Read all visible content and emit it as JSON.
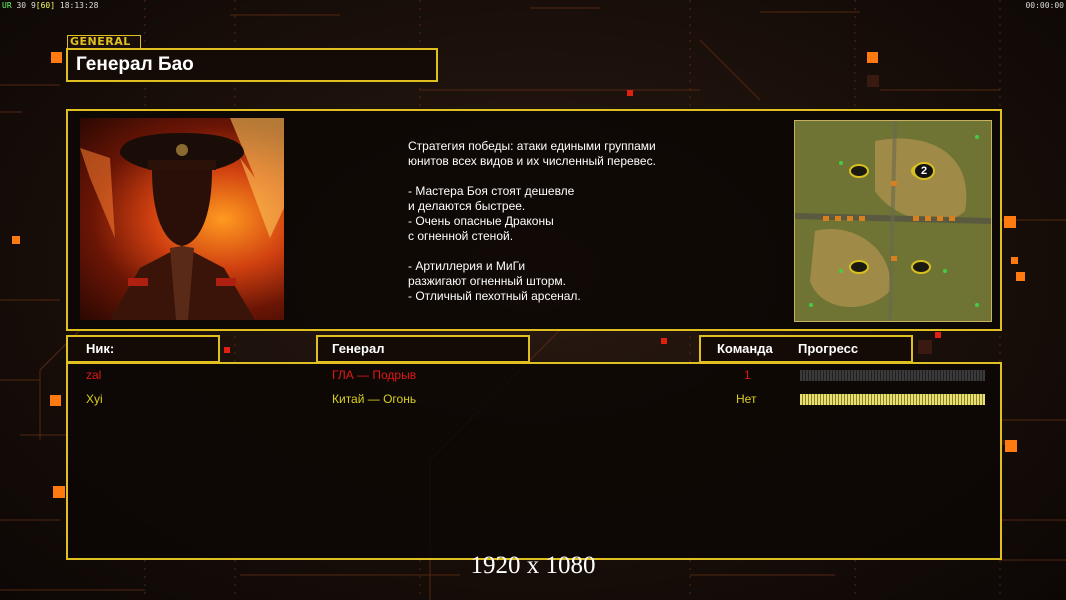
{
  "topbar": {
    "fps_label": "UR",
    "fps_a": "30",
    "fps_b": "9",
    "fps_c": "60",
    "clock": "18:13:28",
    "timer": "00:00:00"
  },
  "general": {
    "section_label": "GENERAL",
    "name": "Генерал Бао",
    "description": "Стратегия победы: атаки едиными группами\nюнитов всех видов и их численный перевес.\n\n- Мастера Боя стоят дешевле\nи делаются быстрее.\n- Очень опасные Драконы\nс огненной стеной.\n\n- Артиллерия и МиГи\nразжигают огненный шторм.\n- Отличный пехотный арсенал."
  },
  "minimap": {
    "start_marker": "2"
  },
  "headers": {
    "nick": "Ник:",
    "general": "Генерал",
    "team": "Команда",
    "progress": "Прогресс"
  },
  "players": [
    {
      "nick": "zal",
      "general": "ГЛА — Подрыв",
      "team": "1",
      "progress": 0.0,
      "color": "#e01818"
    },
    {
      "nick": "Xyi",
      "general": "Китай — Огонь",
      "team": "Нет",
      "progress": 1.0,
      "color": "#d8d020"
    }
  ],
  "footer": {
    "resolution": "1920 x 1080"
  },
  "colors": {
    "frame": "#e0c020",
    "accent": "#ff7a10"
  }
}
